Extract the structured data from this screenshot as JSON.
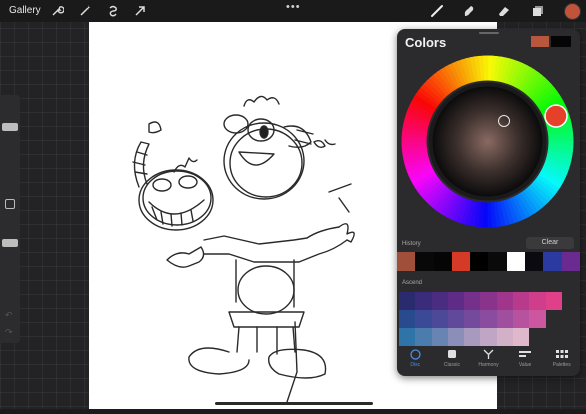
{
  "toolbar": {
    "gallery_label": "Gallery",
    "left_icons": [
      "wrench-icon",
      "magic-wand-icon",
      "selection-icon",
      "transform-arrow-icon"
    ],
    "right_icons": [
      "brush-icon",
      "smudge-icon",
      "eraser-icon",
      "layers-icon"
    ],
    "active_color": "#c0533a"
  },
  "colors_panel": {
    "title": "Colors",
    "current_color": "#b8573e",
    "previous_color": "#050505",
    "history_label": "History",
    "clear_label": "Clear",
    "history_swatches": [
      "#a0503a",
      "#080808",
      "#050505",
      "#d43a26",
      "#000000",
      "#0a0a0a",
      "#ffffff",
      "#0a0a10",
      "#2a3aa0",
      "#6a2a90"
    ],
    "palette_name": "Ascend",
    "palette_rows": [
      [
        "#2a2a6e",
        "#3a2c7a",
        "#4a2c80",
        "#5e2c86",
        "#74308a",
        "#8a338c",
        "#a0368c",
        "#b83a8c",
        "#cf3e8a",
        "#e0408a"
      ],
      [
        "#2a4a90",
        "#3a4a96",
        "#4c4a98",
        "#60489a",
        "#744a9c",
        "#8a4c9e",
        "#a04e9e",
        "#b6529e",
        "#cc56a0"
      ],
      [
        "#2f74a8",
        "#4a7cae",
        "#6884b2",
        "#8a8eb8",
        "#a89abe",
        "#c0a6c4",
        "#d2b0c8",
        "#e0b8cc"
      ]
    ],
    "tabs": [
      {
        "label": "Disc",
        "icon": "disc-icon"
      },
      {
        "label": "Classic",
        "icon": "classic-icon"
      },
      {
        "label": "Harmony",
        "icon": "harmony-icon"
      },
      {
        "label": "Value",
        "icon": "value-icon"
      },
      {
        "label": "Palettes",
        "icon": "palettes-icon"
      }
    ],
    "active_tab": "Disc"
  }
}
